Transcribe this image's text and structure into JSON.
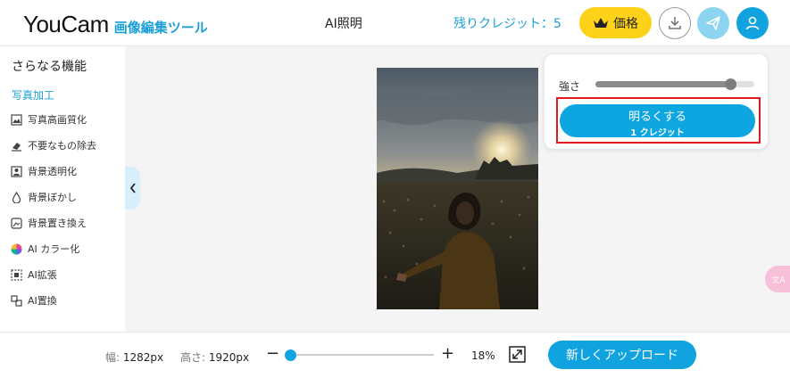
{
  "header": {
    "logo": "YouCam",
    "logo_sub": "画像編集ツール",
    "page_title": "AI照明",
    "credits": "残りクレジット：5",
    "price_label": "価格",
    "icons": [
      "crown-icon",
      "download-icon",
      "send-icon",
      "user-icon"
    ]
  },
  "sidebar": {
    "title": "さらなる機能",
    "section": "写真加工",
    "items": [
      {
        "label": "写真高画質化",
        "icon": "enhance-icon"
      },
      {
        "label": "不要なもの除去",
        "icon": "eraser-icon"
      },
      {
        "label": "背景透明化",
        "icon": "transparent-bg-icon"
      },
      {
        "label": "背景ぼかし",
        "icon": "blur-drop-icon"
      },
      {
        "label": "背景置き換え",
        "icon": "replace-bg-icon"
      },
      {
        "label": "AI カラー化",
        "icon": "color-wheel-icon"
      },
      {
        "label": "AI拡張",
        "icon": "expand-icon"
      },
      {
        "label": "AI置換",
        "icon": "swap-icon"
      }
    ]
  },
  "panel": {
    "strength_label": "強さ",
    "strength_value": 0.85,
    "button_label": "明るくする",
    "button_cost": "1 クレジット",
    "colors": {
      "accent": "#0ea6e1",
      "highlight": "#e1181e"
    }
  },
  "translate_badge": "文A",
  "bottom": {
    "width_label": "幅:",
    "width_value": "1282px",
    "height_label": "高さ:",
    "height_value": "1920px",
    "zoom_minus": "−",
    "zoom_plus": "+",
    "zoom_percent": "18%",
    "zoom_level": 0.0,
    "upload_label": "新しくアップロード"
  }
}
